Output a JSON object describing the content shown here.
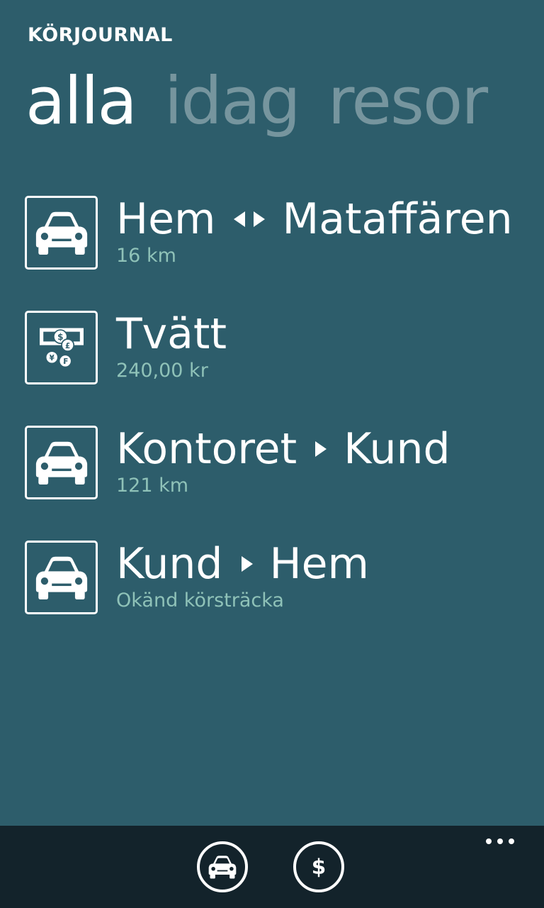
{
  "app": {
    "title": "KÖRJOURNAL"
  },
  "pivot": [
    {
      "label": "alla",
      "active": true
    },
    {
      "label": "idag",
      "active": false
    },
    {
      "label": "resor",
      "active": false
    }
  ],
  "items": [
    {
      "icon": "car-icon",
      "from": "Hem",
      "arrow": "both-arrow-icon",
      "to": "Mataffären",
      "subtitle": "16 km"
    },
    {
      "icon": "money-icon",
      "title": "Tvätt",
      "subtitle": "240,00 kr"
    },
    {
      "icon": "car-icon",
      "from": "Kontoret",
      "arrow": "right-arrow-icon",
      "to": "Kund",
      "subtitle": "121 km"
    },
    {
      "icon": "car-icon",
      "from": "Kund",
      "arrow": "right-arrow-icon",
      "to": "Hem",
      "subtitle": "Okänd körsträcka"
    }
  ],
  "appbar": {
    "buttons": [
      {
        "icon": "car-icon"
      },
      {
        "icon": "dollar-icon"
      }
    ],
    "more_icon": "more-dots-icon"
  },
  "colors": {
    "background": "#2d5d6b",
    "appbar": "#13232b",
    "subtitle": "#8fc2b8"
  }
}
